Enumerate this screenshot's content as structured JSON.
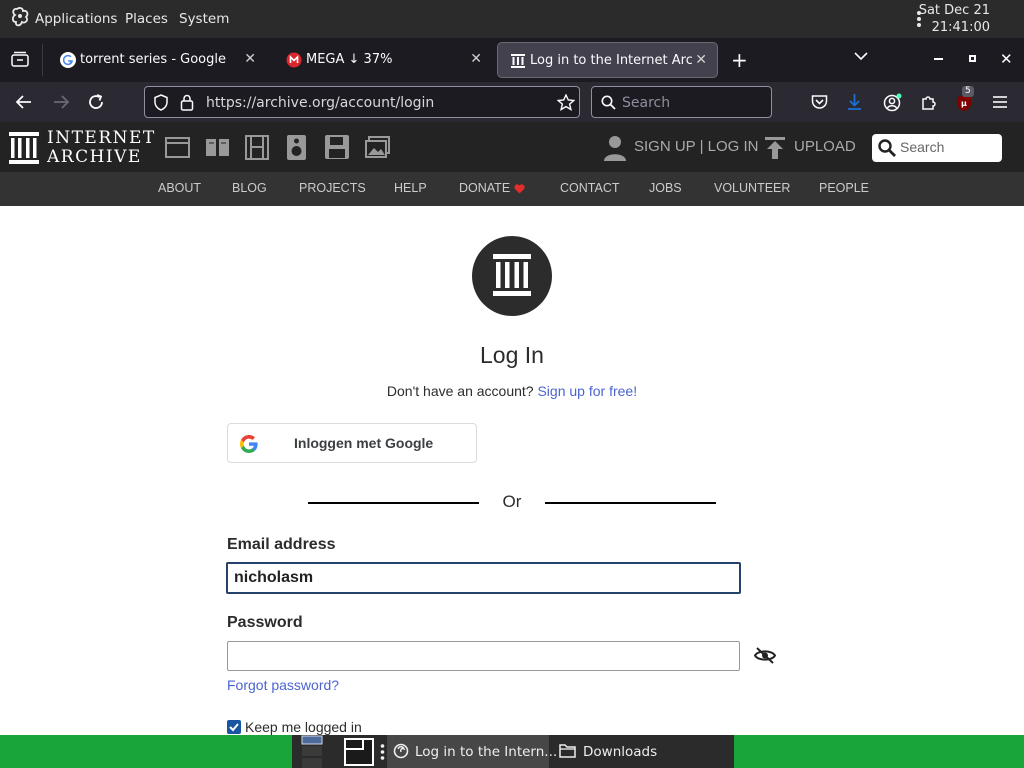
{
  "system_bar": {
    "menus": [
      "Applications",
      "Places",
      "System"
    ],
    "date": "Sat Dec 21",
    "time": "21:41:00"
  },
  "tabs": [
    {
      "title": "torrent series - Google Sear",
      "favicon": "google-icon",
      "active": false
    },
    {
      "title": "MEGA ↓ 37%",
      "favicon": "mega-icon",
      "active": false
    },
    {
      "title": "Log in to the Internet Archiv",
      "favicon": "archive-icon",
      "active": true
    }
  ],
  "toolbar": {
    "url": "https://archive.org/account/login",
    "search_placeholder": "Search",
    "extension_badge": "5"
  },
  "ia_header": {
    "logo_line1": "INTERNET",
    "logo_line2": "ARCHIVE",
    "signup_login": "SIGN UP | LOG IN",
    "upload": "UPLOAD",
    "search_placeholder": "Search",
    "nav": [
      "ABOUT",
      "BLOG",
      "PROJECTS",
      "HELP",
      "DONATE",
      "CONTACT",
      "JOBS",
      "VOLUNTEER",
      "PEOPLE"
    ]
  },
  "login": {
    "title": "Log In",
    "no_account_text": "Don't have an account?",
    "signup_link": "Sign up for free!",
    "google_button": "Inloggen met Google",
    "or_text": "Or",
    "email_label": "Email address",
    "email_value": "nicholasm",
    "password_label": "Password",
    "password_value": "",
    "forgot_password": "Forgot password?",
    "keep_logged_in": "Keep me logged in",
    "keep_logged_in_checked": true
  },
  "taskbar": {
    "items": [
      "Log in to the Intern...",
      "Downloads"
    ]
  },
  "colors": {
    "accent_link": "#4b64d1",
    "panel_green": "#1aa53b",
    "donate_heart": "#e22d2d"
  }
}
